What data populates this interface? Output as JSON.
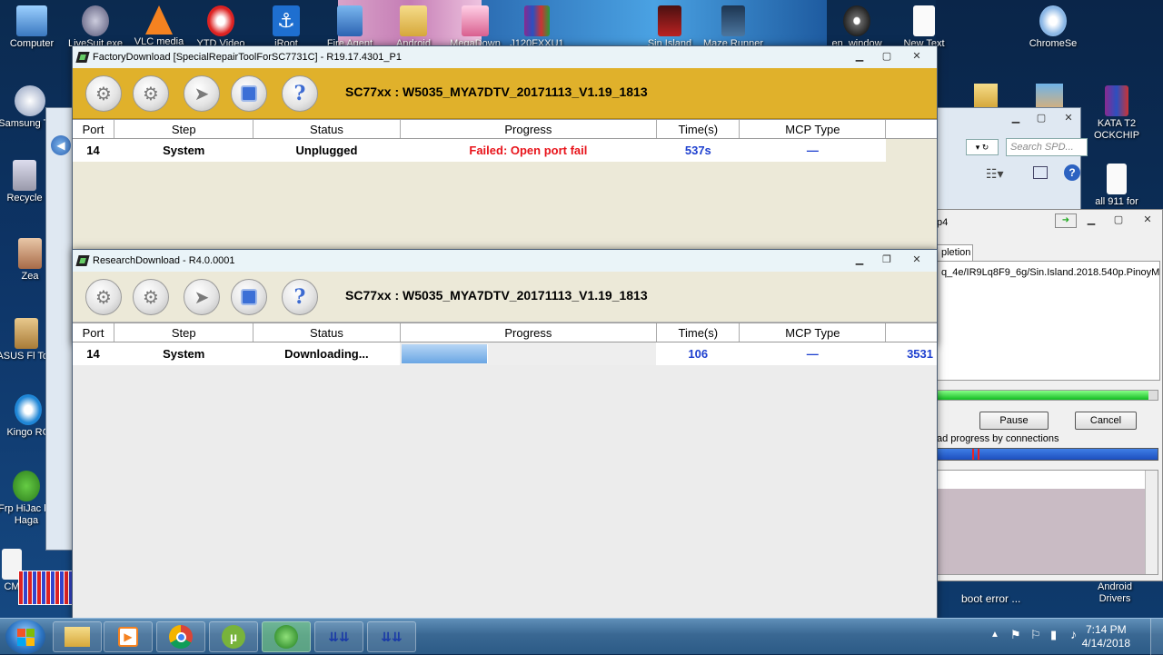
{
  "desktop": {
    "icons_left": [
      {
        "label": "Computer"
      },
      {
        "label": "Samsung Tool"
      },
      {
        "label": "Recycle"
      },
      {
        "label": "Zea"
      },
      {
        "label": "ASUS Fl Tool"
      },
      {
        "label": "Kingo RC"
      },
      {
        "label": "Frp HiJac by Haga"
      },
      {
        "label": "CM"
      }
    ],
    "icons_top": [
      {
        "label": "LiveSuit.exe"
      },
      {
        "label": "VLC media"
      },
      {
        "label": "YTD Video"
      },
      {
        "label": "iRoot"
      },
      {
        "label": "Fire Agent"
      },
      {
        "label": "Android"
      },
      {
        "label": "MegaDown"
      },
      {
        "label": "J120FXXU1"
      },
      {
        "label": "Sin Island"
      },
      {
        "label": "Maze Runner"
      },
      {
        "label": "en_window"
      },
      {
        "label": "New Text"
      },
      {
        "label": "ChromeSe"
      }
    ],
    "icons_right": [
      {
        "label": "KATA T2 OCKCHIP"
      },
      {
        "label": "all 911 for"
      },
      {
        "label": "Android Drivers"
      }
    ],
    "bg_labels": {
      "search_placeholder": "Search SPD...",
      "tab_completion": "pletion",
      "url_text": "q_4e/IR9Lq8F9_6g/Sin.Island.2018.540p.PinoyM",
      "file_suffix": "p4",
      "pause_label": "Pause",
      "cancel_label": "Cancel",
      "progress_caption": "ad progress by connections",
      "boot_error": "boot error ..."
    }
  },
  "factory_window": {
    "title": "FactoryDownload [SpecialRepairToolForSC7731C] - R19.17.4301_P1",
    "firmware": "SC77xx : W5035_MYA7DTV_20171113_V1.19_1813",
    "columns": [
      "Port",
      "Step",
      "Status",
      "Progress",
      "Time(s)",
      "MCP Type"
    ],
    "row": {
      "port": "14",
      "step": "System",
      "status": "Unplugged",
      "progress_text": "Failed: Open port fail",
      "time": "537s",
      "mcp": "—"
    },
    "colors": {
      "title_bg": "#e0b12b",
      "error": "#e8141b",
      "time": "#1d3fcf"
    }
  },
  "research_window": {
    "title": "ResearchDownload - R4.0.0001",
    "firmware": "SC77xx : W5035_MYA7DTV_20171113_V1.19_1813",
    "columns": [
      "Port",
      "Step",
      "Status",
      "Progress",
      "Time(s)",
      "MCP Type"
    ],
    "row": {
      "port": "14",
      "step": "System",
      "status": "Downloading...",
      "progress_fraction": 0.34,
      "time": "106",
      "mcp": "—",
      "extra": "3531"
    },
    "colors": {
      "title_bg": "#eaf4f8",
      "progress": "#7ab3ea",
      "time": "#1d3fcf"
    }
  },
  "taskbar": {
    "time": "7:14 PM",
    "date": "4/14/2018"
  }
}
